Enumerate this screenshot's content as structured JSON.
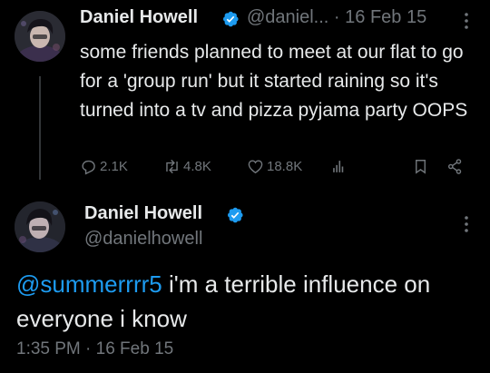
{
  "reply_tweet": {
    "display_name": "Daniel Howell",
    "handle_short": "@daniel...",
    "separator": "·",
    "date": "16 Feb 15",
    "text": "some friends planned to meet at our flat to go for a 'group run' but it started raining so it's turned into a tv and pizza pyjama party OOPS",
    "actions": {
      "replies": "2.1K",
      "retweets": "4.8K",
      "likes": "18.8K"
    }
  },
  "main_tweet": {
    "display_name": "Daniel Howell",
    "handle": "@danielhowell",
    "mention": "@summerrrr5",
    "text": " i'm a terrible influence on everyone i know",
    "timestamp": "1:35 PM · 16 Feb 15"
  },
  "colors": {
    "background": "#000000",
    "text": "#e7e9ea",
    "muted": "#71767b",
    "accent": "#1d9bf0"
  }
}
